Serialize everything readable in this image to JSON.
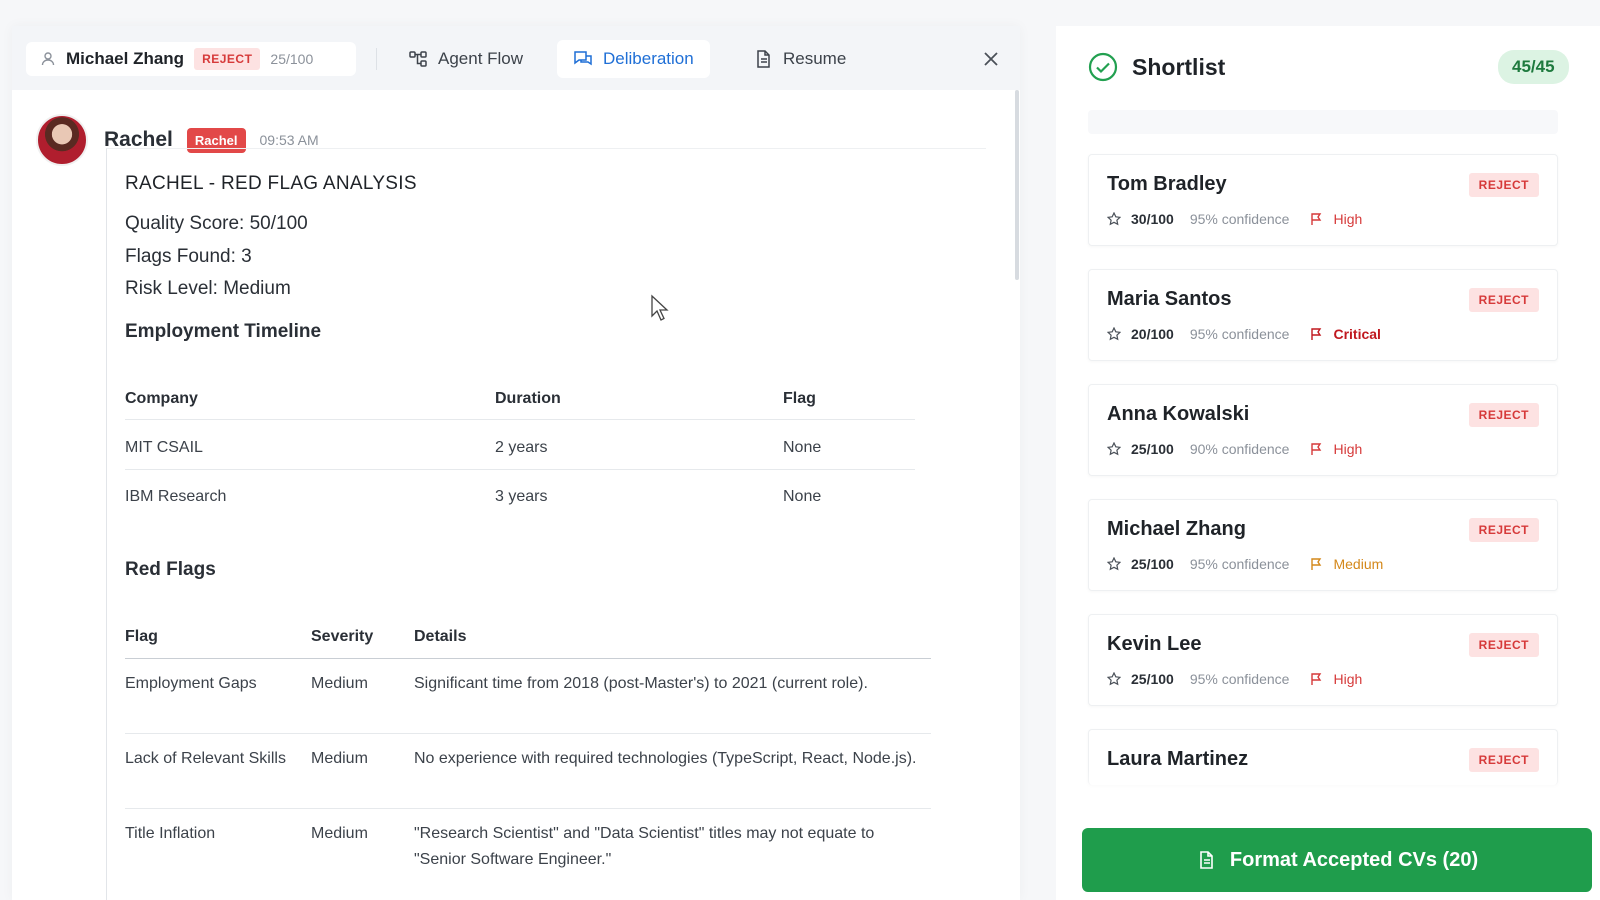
{
  "candidate": {
    "name": "Michael Zhang",
    "status": "REJECT",
    "score": "25/100"
  },
  "tabs": {
    "agent_flow": "Agent Flow",
    "deliberation": "Deliberation",
    "resume": "Resume"
  },
  "message": {
    "sender": "Rachel",
    "badge": "Rachel",
    "time": "09:53 AM",
    "title": "RACHEL - RED FLAG ANALYSIS",
    "quality": "Quality Score: 50/100",
    "flags": "Flags Found: 3",
    "risk": "Risk Level: Medium",
    "timeline_heading": "Employment Timeline",
    "timeline_headers": [
      "Company",
      "Duration",
      "Flag"
    ],
    "timeline_rows": [
      [
        "MIT CSAIL",
        "2 years",
        "None"
      ],
      [
        "IBM Research",
        "3 years",
        "None"
      ]
    ],
    "redflags_heading": "Red Flags",
    "redflag_headers": [
      "Flag",
      "Severity",
      "Details"
    ],
    "redflag_rows": [
      [
        "Employment Gaps",
        "Medium",
        "Significant time from 2018 (post-Master's) to 2021 (current role)."
      ],
      [
        "Lack of Relevant Skills",
        "Medium",
        "No experience with required technologies (TypeScript, React, Node.js)."
      ],
      [
        "Title Inflation",
        "Medium",
        "\"Research Scientist\" and \"Data Scientist\" titles may not equate to \"Senior Software Engineer.\""
      ]
    ]
  },
  "shortlist": {
    "title": "Shortlist",
    "count": "45/45",
    "cards": [
      {
        "name": "Tom Bradley",
        "status": "REJECT",
        "score": "30/100",
        "confidence": "95% confidence",
        "risk": "High"
      },
      {
        "name": "Maria Santos",
        "status": "REJECT",
        "score": "20/100",
        "confidence": "95% confidence",
        "risk": "Critical"
      },
      {
        "name": "Anna Kowalski",
        "status": "REJECT",
        "score": "25/100",
        "confidence": "90% confidence",
        "risk": "High"
      },
      {
        "name": "Michael Zhang",
        "status": "REJECT",
        "score": "25/100",
        "confidence": "95% confidence",
        "risk": "Medium"
      },
      {
        "name": "Kevin Lee",
        "status": "REJECT",
        "score": "25/100",
        "confidence": "95% confidence",
        "risk": "High"
      },
      {
        "name": "Laura Martinez",
        "status": "REJECT"
      }
    ]
  },
  "cta_label": "Format Accepted CVs (20)",
  "colors": {
    "accent_blue": "#1f6fd6",
    "reject_red": "#d63a3a",
    "success_green": "#1f9d4c",
    "medium_orange": "#d4881a"
  }
}
